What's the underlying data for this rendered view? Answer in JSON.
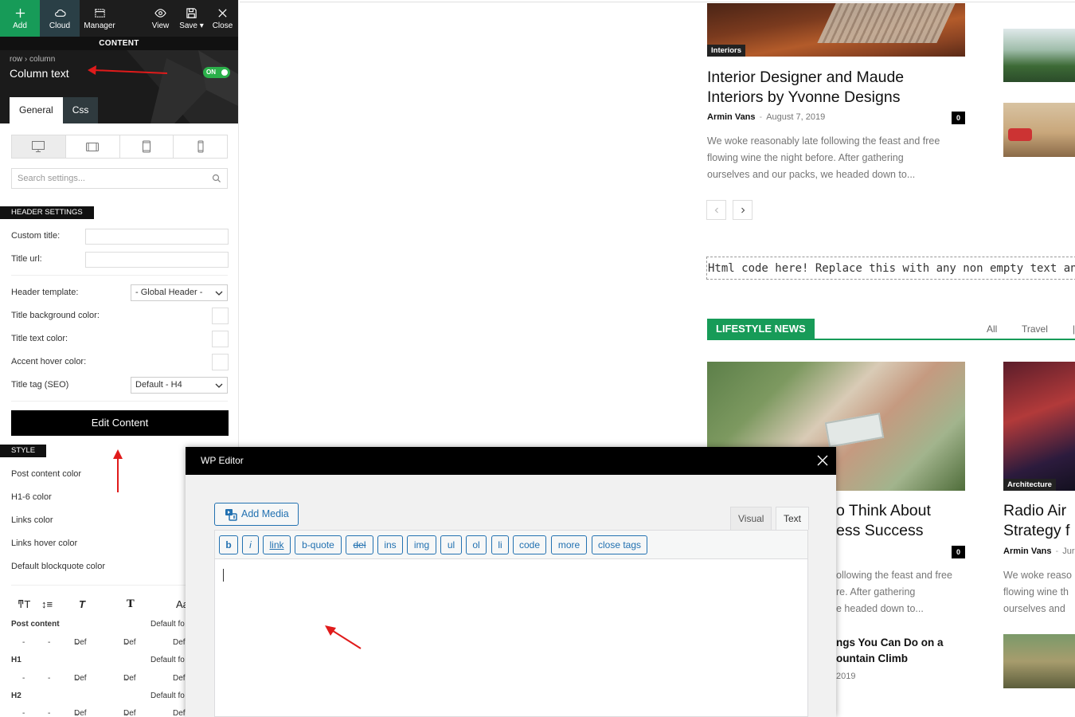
{
  "panel": {
    "toolbar": {
      "add": "Add",
      "cloud": "Cloud",
      "manager": "Manager",
      "view": "View",
      "save": "Save",
      "close": "Close"
    },
    "content_label": "CONTENT",
    "breadcrumb": {
      "row": "row",
      "sep": "›",
      "column": "column"
    },
    "title": "Column text",
    "toggle": "ON",
    "tabs": {
      "general": "General",
      "css": "Css"
    },
    "search_placeholder": "Search settings...",
    "header_settings": {
      "label": "HEADER SETTINGS",
      "custom_title": "Custom title:",
      "title_url": "Title url:",
      "header_template": "Header template:",
      "header_template_value": "- Global Header -",
      "title_bg_color": "Title background color:",
      "title_text_color": "Title text color:",
      "accent_hover_color": "Accent hover color:",
      "title_tag": "Title tag (SEO)",
      "title_tag_value": "Default - H4"
    },
    "edit_content": "Edit Content",
    "style": {
      "label": "STYLE",
      "items": [
        "Post content color",
        "H1-6 color",
        "Links color",
        "Links hover color",
        "Default blockquote color"
      ]
    },
    "typography": {
      "icon_aa": "Aa",
      "rows": [
        {
          "name": "Post content",
          "default": "Default fo"
        },
        {
          "name": "H1",
          "default": "Default fo"
        },
        {
          "name": "H2",
          "default": "Default fo"
        }
      ],
      "dash": "-",
      "def": "Def"
    }
  },
  "articles": {
    "featured": {
      "category": "Interiors",
      "title_line1": "Interior Designer and Maude",
      "title_line2": "Interiors by Yvonne Designs",
      "author": "Armin Vans",
      "meta_sep": "-",
      "date": "August 7, 2019",
      "comments": "0",
      "excerpt_lines": [
        "We woke reasonably late following the feast and free",
        "flowing wine the night before. After gathering",
        "ourselves and our packs, we headed down to..."
      ]
    },
    "html_code": "Html code here! Replace this with any non empty text and th",
    "lifestyle": {
      "label": "LIFESTYLE NEWS",
      "tabs": [
        "All",
        "Travel"
      ]
    },
    "second": {
      "title_line1": "o Think About",
      "title_line2": "ess Success",
      "comments": "0",
      "excerpt_lines": [
        "ollowing the feast and free",
        "re. After gathering",
        "e headed down to..."
      ]
    },
    "small": {
      "title_line1": "ngs You Can Do on a",
      "title_line2": "ountain Climb",
      "date": "2019"
    },
    "right": {
      "category": "Architecture",
      "title_line1": "Radio Air",
      "title_line2": "Strategy f",
      "author": "Armin Vans",
      "meta_sep": "-",
      "date": "Jur",
      "excerpt_lines": [
        "We woke reaso",
        "flowing wine th",
        "ourselves and"
      ]
    }
  },
  "modal": {
    "title": "WP Editor",
    "add_media": "Add Media",
    "tab_visual": "Visual",
    "tab_text": "Text",
    "quicktags": [
      "b",
      "i",
      "link",
      "b-quote",
      "del",
      "ins",
      "img",
      "ul",
      "ol",
      "li",
      "code",
      "more",
      "close tags"
    ]
  },
  "colors": {
    "accent_green": "#179b58",
    "wp_blue": "#2271b1",
    "annotation_red": "#e01b1b"
  }
}
